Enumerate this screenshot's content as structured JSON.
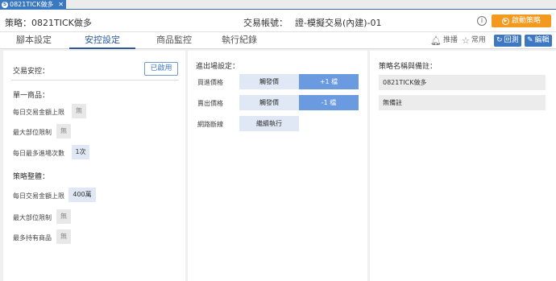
{
  "window_tab": {
    "title": "0821TICK做多",
    "close": "✕"
  },
  "header": {
    "strategy_label": "策略：0821TICK做多",
    "account_label": "交易帳號：",
    "account_value": "證-模擬交易(內建)-01",
    "start_button": "啟動策略"
  },
  "tabs": [
    {
      "label": "腳本設定",
      "active": false
    },
    {
      "label": "安控設定",
      "active": true
    },
    {
      "label": "商品監控",
      "active": false
    },
    {
      "label": "執行紀錄",
      "active": false
    }
  ],
  "toolbar": {
    "push_label": "推播",
    "favorite_label": "常用",
    "backtest_label": "回測",
    "edit_label": "編輯"
  },
  "risk_control": {
    "title": "交易安控：",
    "enabled_label": "已啟用",
    "single_title": "單一商品：",
    "single_rows": [
      {
        "label": "每日交易金額上限",
        "value": "無"
      },
      {
        "label": "最大部位限制",
        "value": "無"
      },
      {
        "label": "每日最多進場次數",
        "value": "1次"
      }
    ],
    "overall_title": "策略整體：",
    "overall_rows": [
      {
        "label": "每日交易金額上限",
        "value": "400萬"
      },
      {
        "label": "最大部位限制",
        "value": "無"
      },
      {
        "label": "最多持有商品",
        "value": "無"
      }
    ]
  },
  "entry_exit": {
    "title": "進出場設定：",
    "buy_label": "買進價格",
    "buy_trigger": "觸發價",
    "buy_ticks": "+1 檔",
    "sell_label": "賣出價格",
    "sell_trigger": "觸發價",
    "sell_ticks": "-1 檔",
    "disconnect_label": "網路斷線",
    "disconnect_value": "繼續執行"
  },
  "notes": {
    "title": "策略名稱與備註：",
    "name": "0821TICK做多",
    "remark": "無備註"
  },
  "colors": {
    "accent_blue": "#3f78c2",
    "start_orange": "#f39a1e"
  }
}
